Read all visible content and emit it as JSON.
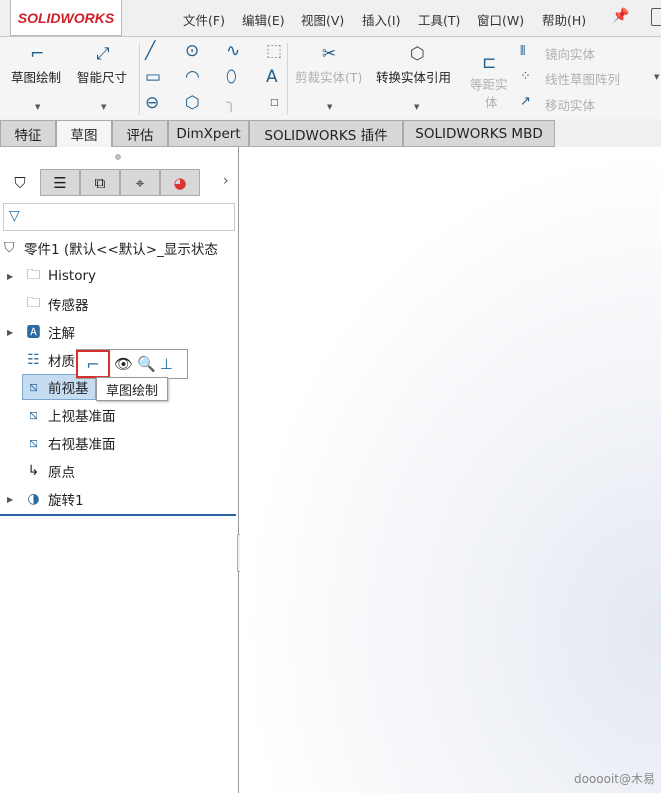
{
  "app": {
    "logo": "SOLIDWORKS"
  },
  "menu": [
    "文件(F)",
    "编辑(E)",
    "视图(V)",
    "插入(I)",
    "工具(T)",
    "窗口(W)",
    "帮助(H)"
  ],
  "toolbar": {
    "sketch": "草图绘制",
    "smart_dim": "智能尺寸",
    "trim": "剪裁实体(T)",
    "convert": "转换实体引用",
    "offset_line1": "等距实",
    "offset_line2": "体",
    "mirror": "镜向实体",
    "linear_pattern": "线性草图阵列",
    "move": "移动实体"
  },
  "tabs": [
    "特征",
    "草图",
    "评估",
    "DimXpert",
    "SOLIDWORKS 插件",
    "SOLIDWORKS MBD"
  ],
  "active_tab": "草图",
  "tree": {
    "root": "零件1  (默认<<默认>_显示状态",
    "items": [
      "History",
      "传感器",
      "注解",
      "材质",
      "前视基",
      "上视基准面",
      "右视基准面",
      "原点",
      "旋转1"
    ]
  },
  "popup": {
    "tooltip": "草图绘制"
  },
  "watermark": "dooooit@木易"
}
